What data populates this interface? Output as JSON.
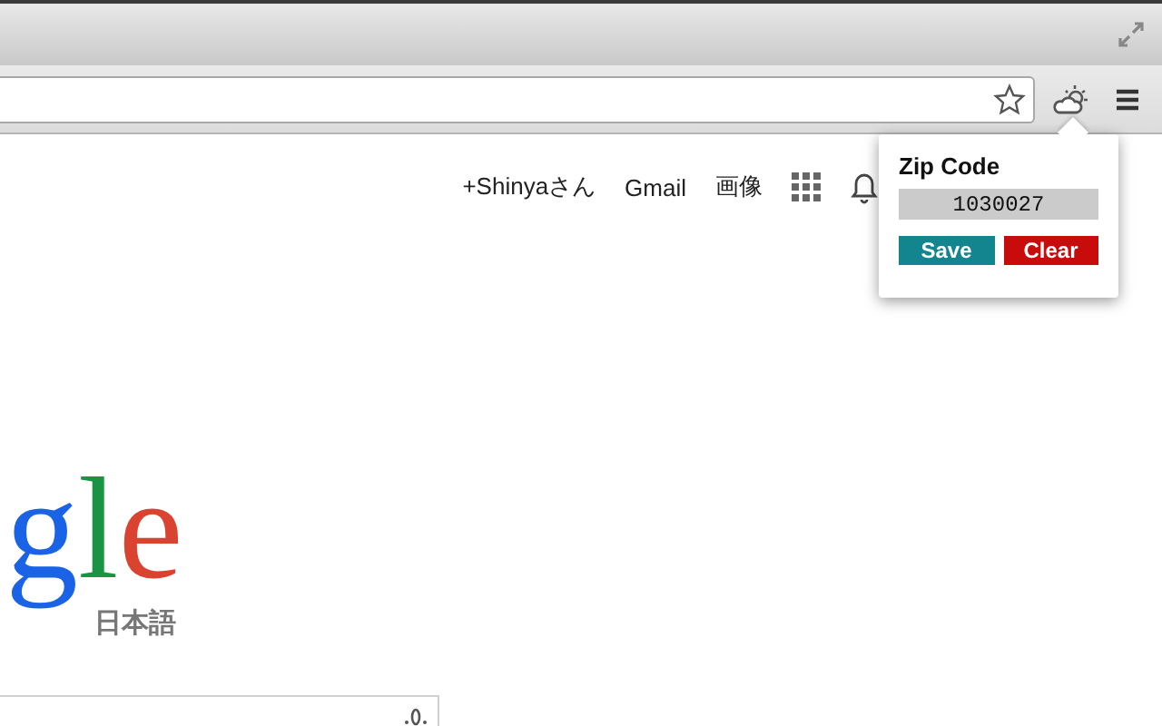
{
  "header_links": [
    {
      "label": "+Shinyaさん"
    },
    {
      "label": "Gmail"
    },
    {
      "label": "画像"
    }
  ],
  "popup": {
    "title": "Zip Code",
    "zip_value": "1030027",
    "buttons": [
      {
        "label": "Save",
        "kind": "save"
      },
      {
        "label": "Clear",
        "kind": "clear"
      }
    ]
  },
  "logo": {
    "letters": [
      {
        "text": "g",
        "color": "#1a62e6"
      },
      {
        "text": "l",
        "color": "#1a9442"
      },
      {
        "text": "e",
        "color": "#d9432f"
      }
    ],
    "subtitle": "日本語"
  }
}
